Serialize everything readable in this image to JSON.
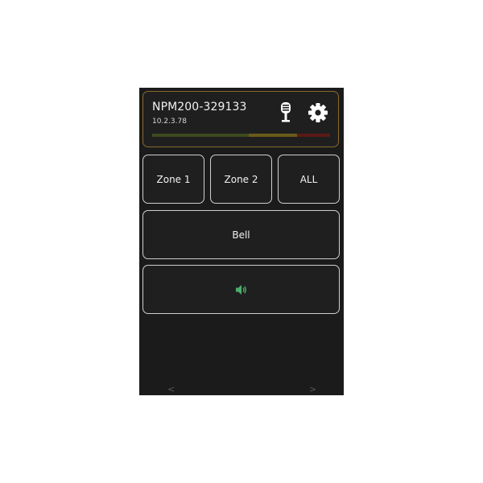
{
  "header": {
    "device_name": "NPM200-329133",
    "device_ip": "10.2.3.78",
    "mic_icon": "microphone-icon",
    "settings_icon": "gear-icon",
    "level_colors": [
      "#3d4a1e",
      "#6a5a18",
      "#5a1a16"
    ],
    "border_color": "#8a6a30"
  },
  "buttons": {
    "zone1": "Zone 1",
    "zone2": "Zone 2",
    "all": "ALL",
    "bell": "Bell",
    "volume_icon": "speaker-icon",
    "volume_icon_color": "#4caf6a"
  },
  "nav": {
    "prev": "<",
    "next": ">"
  }
}
